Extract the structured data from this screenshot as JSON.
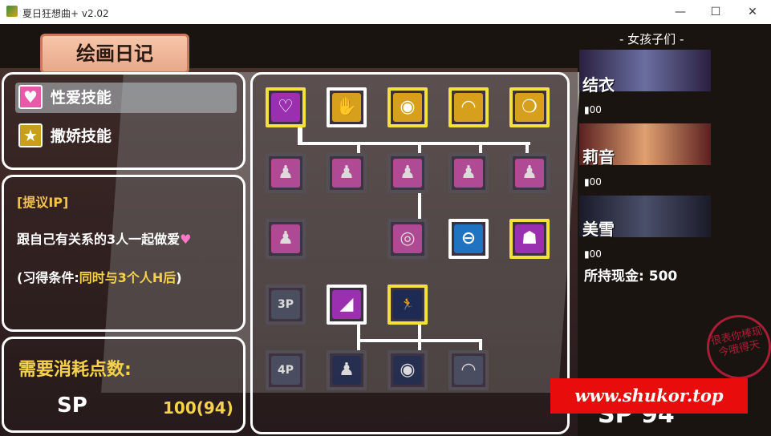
{
  "window": {
    "title": "夏日狂想曲+ v2.02",
    "minimize_glyph": "—",
    "maximize_glyph": "☐",
    "close_glyph": "✕"
  },
  "header": {
    "title": "绘画日记"
  },
  "categories": [
    {
      "label": "性爱技能",
      "icon": "heart-icon",
      "glyph": "♥",
      "color": "#e85aa8"
    },
    {
      "label": "撒娇技能",
      "icon": "star-icon",
      "glyph": "★",
      "color": "#c8a018"
    }
  ],
  "proposal": {
    "title": "[提议IP]",
    "description": "跟自己有关系的3人一起做爱",
    "heart": "♥",
    "condition_prefix": "(习得条件:",
    "condition_highlight": "同时与3个人H后",
    "condition_suffix": ")"
  },
  "cost": {
    "title": "需要消耗点数:",
    "currency": "SP",
    "value": "100(94)"
  },
  "skill_grid": [
    [
      {
        "icon": "kiss-pose-icon",
        "glyph": "♡",
        "color": "g-purple",
        "state": "acq"
      },
      {
        "icon": "hand-icon",
        "glyph": "✋",
        "color": "g-gold",
        "state": "sel"
      },
      {
        "icon": "lips-icon",
        "glyph": "◉",
        "color": "g-gold",
        "state": "acq"
      },
      {
        "icon": "chest-icon",
        "glyph": "◠",
        "color": "g-gold",
        "state": "acq"
      },
      {
        "icon": "speech-bubble-icon",
        "glyph": "❍",
        "color": "g-gold",
        "state": "acq"
      }
    ],
    [
      {
        "icon": "pose-a-icon",
        "glyph": "♟",
        "color": "g-pink",
        "state": "lock"
      },
      {
        "icon": "pose-b-icon",
        "glyph": "♟",
        "color": "g-pink",
        "state": "lock"
      },
      {
        "icon": "pose-c-icon",
        "glyph": "♟",
        "color": "g-pink",
        "state": "lock"
      },
      {
        "icon": "pose-d-icon",
        "glyph": "♟",
        "color": "g-pink",
        "state": "lock"
      },
      {
        "icon": "pose-e-icon",
        "glyph": "♟",
        "color": "g-pink",
        "state": "lock"
      }
    ],
    [
      {
        "icon": "pose-f-icon",
        "glyph": "♟",
        "color": "g-pink",
        "state": "lock"
      },
      null,
      {
        "icon": "mouth-icon",
        "glyph": "◎",
        "color": "g-pink",
        "state": "lock"
      },
      {
        "icon": "no-entry-icon",
        "glyph": "⊖",
        "color": "g-blue",
        "state": "sel"
      },
      {
        "icon": "ghost-icon",
        "glyph": "☗",
        "color": "g-purple",
        "state": "acq"
      }
    ],
    [
      {
        "icon": "threesome-icon",
        "glyph": "3P",
        "color": "g-dim",
        "state": "lock"
      },
      {
        "icon": "toy-icon",
        "glyph": "◢",
        "color": "g-purple",
        "state": "sel"
      },
      {
        "icon": "running-icon",
        "glyph": "🏃",
        "color": "g-navy",
        "state": "acq"
      },
      null,
      null
    ],
    [
      {
        "icon": "foursome-icon",
        "glyph": "4P",
        "color": "g-dim",
        "state": "lock"
      },
      {
        "icon": "pose-g-icon",
        "glyph": "♟",
        "color": "g-navy",
        "state": "lock"
      },
      {
        "icon": "lips-dark-icon",
        "glyph": "◉",
        "color": "g-navy",
        "state": "lock"
      },
      {
        "icon": "chest-dark-icon",
        "glyph": "◠",
        "color": "g-dim",
        "state": "lock"
      },
      null
    ]
  ],
  "stamp": {
    "text": "很表你棒现今哦得天"
  },
  "girls": {
    "title": "- 女孩子们 -",
    "list": [
      {
        "name": "结衣",
        "stat": "▮00",
        "color": "#6a6fa0"
      },
      {
        "name": "莉音",
        "stat": "▮00",
        "color": "#e0a070"
      },
      {
        "name": "美雪",
        "stat": "▮00",
        "color": "#4a4f6a"
      }
    ]
  },
  "money": {
    "label": "所持现金:",
    "value": "500"
  },
  "bottom": {
    "sp": "SP  94"
  },
  "watermark": {
    "text": "www.shukor.top"
  }
}
